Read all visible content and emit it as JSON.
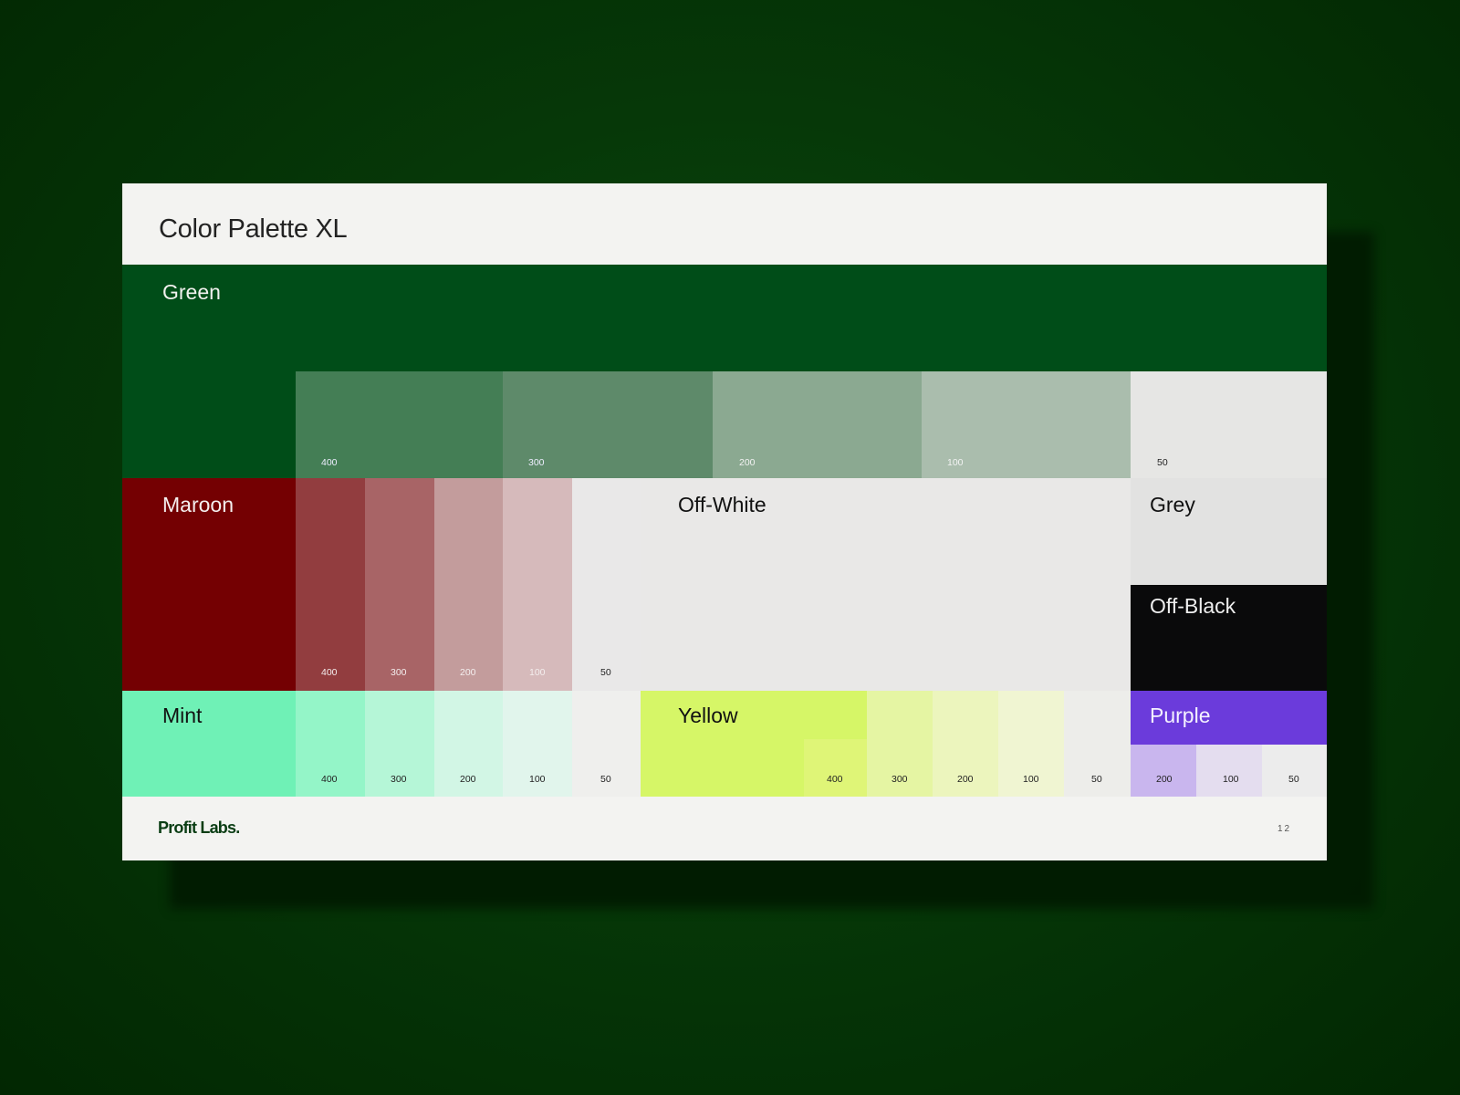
{
  "title": "Color Palette XL",
  "colors": {
    "green": {
      "name": "Green",
      "base": "#004d18",
      "s400": "#447e55",
      "s300": "#5e8a6a",
      "s200": "#8ba991",
      "s100": "#aabdad",
      "s50": "#e6e6e4"
    },
    "maroon": {
      "name": "Maroon",
      "base": "#740002",
      "s400": "#923d3f",
      "s300": "#a86466",
      "s200": "#c39c9c",
      "s100": "#d6babb",
      "s50": "#e9e8e8"
    },
    "offwhite": {
      "name": "Off-White",
      "base": "#e9e8e7"
    },
    "grey": {
      "name": "Grey",
      "base": "#e2e2e1"
    },
    "offblack": {
      "name": "Off-Black",
      "base": "#0a0a0b"
    },
    "mint": {
      "name": "Mint",
      "base": "#6ff1b6",
      "s400": "#94f5c8",
      "s300": "#b5f6d7",
      "s200": "#d2f6e5",
      "s100": "#e1f5ec",
      "s50": "#efefed"
    },
    "yellow": {
      "name": "Yellow",
      "base": "#d6f667",
      "s400": "#dff577",
      "s300": "#e5f5a3",
      "s200": "#ecf5bd",
      "s100": "#f0f5d2",
      "s50": "#ededea"
    },
    "purple": {
      "name": "Purple",
      "base": "#6b3bdb",
      "s200": "#c9b6ee",
      "s100": "#e4ddef",
      "s50": "#ececec"
    }
  },
  "shades": {
    "s400": "400",
    "s300": "300",
    "s200": "200",
    "s100": "100",
    "s50": "50"
  },
  "footer": {
    "brand": "Profit Labs.",
    "page": "12"
  }
}
